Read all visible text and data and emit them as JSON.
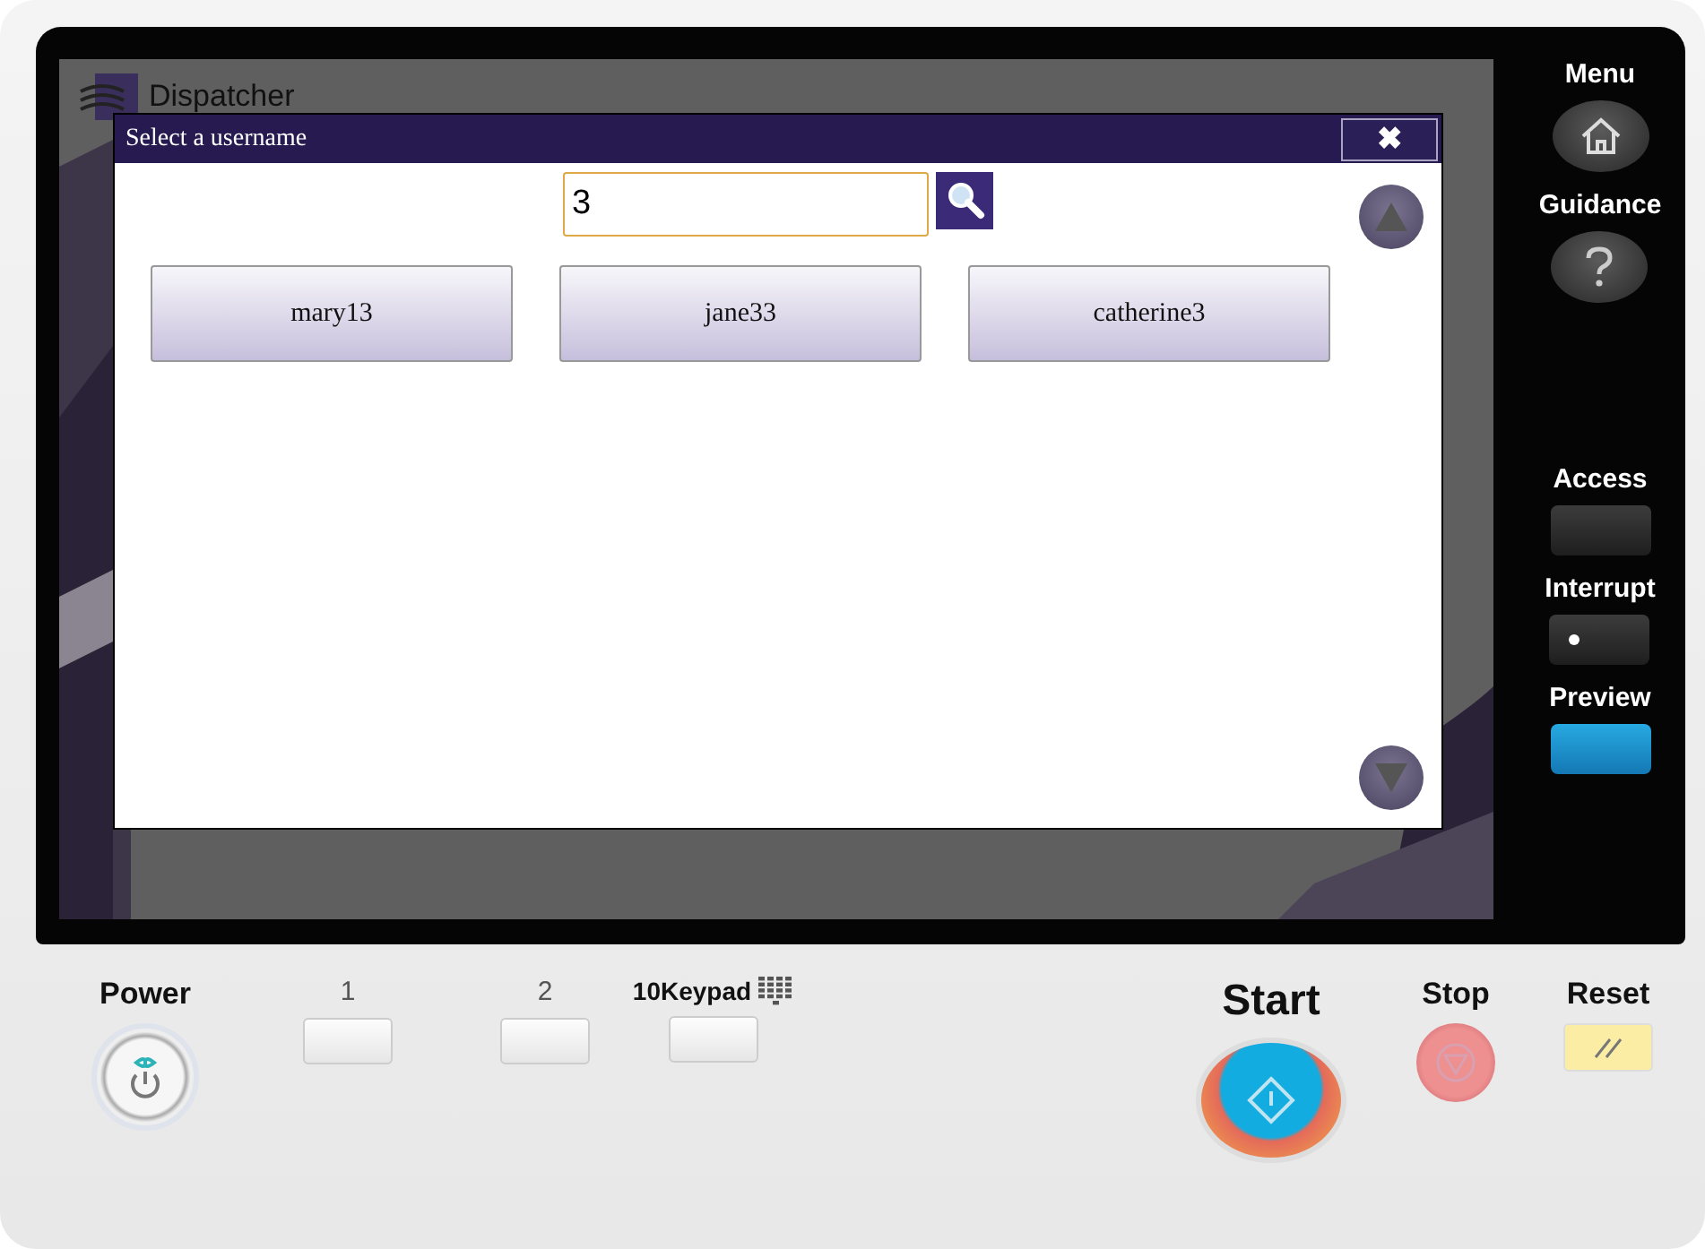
{
  "app_header": {
    "title": "Dispatcher"
  },
  "dialog": {
    "title": "Select a username",
    "close": "✖",
    "search": {
      "value": "3"
    },
    "users": [
      {
        "label": "mary13"
      },
      {
        "label": "jane33"
      },
      {
        "label": "catherine3"
      }
    ]
  },
  "side_panel": [
    {
      "label": "Menu",
      "kind": "home"
    },
    {
      "label": "Guidance",
      "kind": "help"
    },
    {
      "label": "Access",
      "kind": "key",
      "lit": false,
      "led": false
    },
    {
      "label": "Interrupt",
      "kind": "key",
      "lit": false,
      "led": true
    },
    {
      "label": "Preview",
      "kind": "key",
      "lit": true,
      "led": false
    }
  ],
  "control_panel": [
    {
      "label": "Power",
      "kind": "power"
    },
    {
      "label": "1",
      "kind": "memory"
    },
    {
      "label": "2",
      "kind": "memory"
    },
    {
      "label": "10Keypad",
      "kind": "keypad"
    },
    {
      "label": "Start",
      "kind": "start"
    },
    {
      "label": "Stop",
      "kind": "stop"
    },
    {
      "label": "Reset",
      "kind": "reset"
    }
  ]
}
